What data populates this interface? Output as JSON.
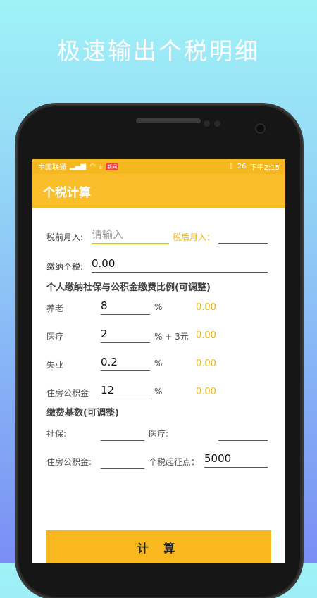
{
  "headline": "极速输出个税明细",
  "status_bar": {
    "carrier": "中国联通",
    "signal": "4G",
    "notif_badge": "新闻",
    "battery": "26",
    "time": "下午2:15"
  },
  "app_bar": {
    "title": "个税计算"
  },
  "income": {
    "pre_tax_label": "税前月入:",
    "pre_tax_placeholder": "请输入",
    "post_tax_label": "税后月入：",
    "post_tax_value": ""
  },
  "tax": {
    "label": "缴纳个税:",
    "value": "0.00"
  },
  "ratio_section": {
    "title": "个人缴纳社保与公积金缴费比例(可调整)",
    "rows": [
      {
        "label": "养老",
        "value": "8",
        "unit": "%",
        "result": "0.00"
      },
      {
        "label": "医疗",
        "value": "2",
        "unit": "% + 3元",
        "result": "0.00"
      },
      {
        "label": "失业",
        "value": "0.2",
        "unit": "%",
        "result": "0.00"
      },
      {
        "label": "住房公积金",
        "value": "12",
        "unit": "%",
        "result": "0.00"
      }
    ]
  },
  "base_section": {
    "title": "缴费基数(可调整)",
    "social_label": "社保:",
    "social_value": "",
    "medical_label": "医疗:",
    "medical_value": "",
    "fund_label": "住房公积金:",
    "fund_value": "",
    "threshold_label": "个税起征点：",
    "threshold_value": "5000"
  },
  "calculate_button": "计 算",
  "colors": {
    "accent": "#fbbe2b",
    "value": "#f0b510"
  }
}
